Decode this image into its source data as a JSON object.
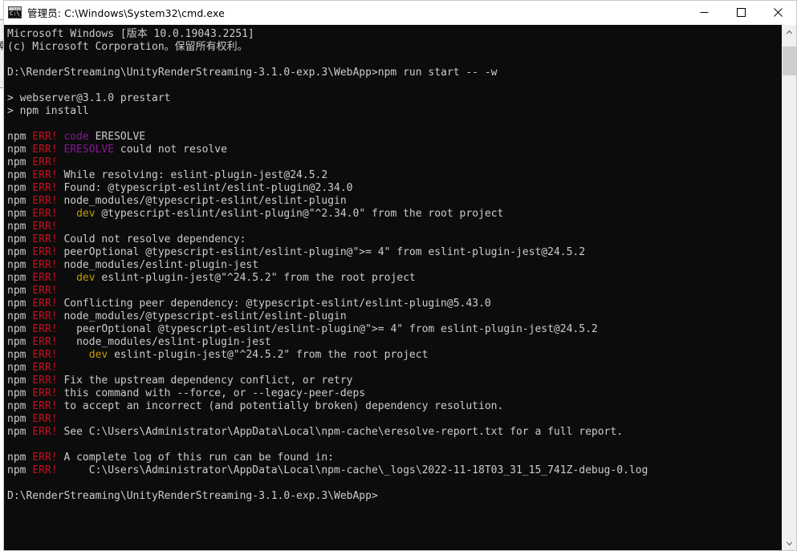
{
  "window": {
    "title": "管理员: C:\\Windows\\System32\\cmd.exe",
    "icon_name": "cmd-console-icon",
    "icon_glyph": "C:\\_",
    "controls": {
      "minimize_label": "最小化",
      "maximize_label": "最大化",
      "close_label": "关闭"
    }
  },
  "background_fragment": {
    "glyph": "朝"
  },
  "scrollbar": {
    "up_arrow": "▲",
    "down_arrow": "▼"
  },
  "colors": {
    "console_background": "#0c0c0c",
    "text_white": "#cccccc",
    "text_red": "#c50f1f",
    "text_magenta": "#881798",
    "text_yellow": "#c19c00",
    "titlebar_background": "#ffffff",
    "scrollbar_track": "#f0f0f0",
    "scrollbar_thumb": "#cdcdcd"
  },
  "console": {
    "prompt_path": "D:\\RenderStreaming\\UnityRenderStreaming-3.1.0-exp.3\\WebApp>",
    "command": "npm run start -- -w",
    "lines": [
      [
        {
          "t": "Microsoft Windows [版本 10.0.19043.2251]",
          "c": "c-white"
        }
      ],
      [
        {
          "t": "(c) Microsoft Corporation。保留所有权利。",
          "c": "c-white"
        }
      ],
      [
        {
          "t": "",
          "c": "c-white"
        }
      ],
      [
        {
          "t": "D:\\RenderStreaming\\UnityRenderStreaming-3.1.0-exp.3\\WebApp>npm run start -- -w",
          "c": "c-white"
        }
      ],
      [
        {
          "t": "",
          "c": "c-white"
        }
      ],
      [
        {
          "t": "> webserver@3.1.0 prestart",
          "c": "c-white"
        }
      ],
      [
        {
          "t": "> npm install",
          "c": "c-white"
        }
      ],
      [
        {
          "t": "",
          "c": "c-white"
        }
      ],
      [
        {
          "t": "npm ",
          "c": "c-white"
        },
        {
          "t": "ERR!",
          "c": "c-red"
        },
        {
          "t": " ",
          "c": "c-white"
        },
        {
          "t": "code",
          "c": "c-magenta"
        },
        {
          "t": " ERESOLVE",
          "c": "c-white"
        }
      ],
      [
        {
          "t": "npm ",
          "c": "c-white"
        },
        {
          "t": "ERR!",
          "c": "c-red"
        },
        {
          "t": " ",
          "c": "c-white"
        },
        {
          "t": "ERESOLVE",
          "c": "c-magenta"
        },
        {
          "t": " could not resolve",
          "c": "c-white"
        }
      ],
      [
        {
          "t": "npm ",
          "c": "c-white"
        },
        {
          "t": "ERR!",
          "c": "c-red"
        }
      ],
      [
        {
          "t": "npm ",
          "c": "c-white"
        },
        {
          "t": "ERR!",
          "c": "c-red"
        },
        {
          "t": " While resolving: eslint-plugin-jest@24.5.2",
          "c": "c-white"
        }
      ],
      [
        {
          "t": "npm ",
          "c": "c-white"
        },
        {
          "t": "ERR!",
          "c": "c-red"
        },
        {
          "t": " Found: @typescript-eslint/eslint-plugin@2.34.0",
          "c": "c-white"
        }
      ],
      [
        {
          "t": "npm ",
          "c": "c-white"
        },
        {
          "t": "ERR!",
          "c": "c-red"
        },
        {
          "t": " node_modules/@typescript-eslint/eslint-plugin",
          "c": "c-white"
        }
      ],
      [
        {
          "t": "npm ",
          "c": "c-white"
        },
        {
          "t": "ERR!",
          "c": "c-red"
        },
        {
          "t": "   ",
          "c": "c-white"
        },
        {
          "t": "dev",
          "c": "c-yellow"
        },
        {
          "t": " @typescript-eslint/eslint-plugin@\"^2.34.0\" from the root project",
          "c": "c-white"
        }
      ],
      [
        {
          "t": "npm ",
          "c": "c-white"
        },
        {
          "t": "ERR!",
          "c": "c-red"
        }
      ],
      [
        {
          "t": "npm ",
          "c": "c-white"
        },
        {
          "t": "ERR!",
          "c": "c-red"
        },
        {
          "t": " Could not resolve dependency:",
          "c": "c-white"
        }
      ],
      [
        {
          "t": "npm ",
          "c": "c-white"
        },
        {
          "t": "ERR!",
          "c": "c-red"
        },
        {
          "t": " peerOptional @typescript-eslint/eslint-plugin@\">= 4\" from eslint-plugin-jest@24.5.2",
          "c": "c-white"
        }
      ],
      [
        {
          "t": "npm ",
          "c": "c-white"
        },
        {
          "t": "ERR!",
          "c": "c-red"
        },
        {
          "t": " node_modules/eslint-plugin-jest",
          "c": "c-white"
        }
      ],
      [
        {
          "t": "npm ",
          "c": "c-white"
        },
        {
          "t": "ERR!",
          "c": "c-red"
        },
        {
          "t": "   ",
          "c": "c-white"
        },
        {
          "t": "dev",
          "c": "c-yellow"
        },
        {
          "t": " eslint-plugin-jest@\"^24.5.2\" from the root project",
          "c": "c-white"
        }
      ],
      [
        {
          "t": "npm ",
          "c": "c-white"
        },
        {
          "t": "ERR!",
          "c": "c-red"
        }
      ],
      [
        {
          "t": "npm ",
          "c": "c-white"
        },
        {
          "t": "ERR!",
          "c": "c-red"
        },
        {
          "t": " Conflicting peer dependency: @typescript-eslint/eslint-plugin@5.43.0",
          "c": "c-white"
        }
      ],
      [
        {
          "t": "npm ",
          "c": "c-white"
        },
        {
          "t": "ERR!",
          "c": "c-red"
        },
        {
          "t": " node_modules/@typescript-eslint/eslint-plugin",
          "c": "c-white"
        }
      ],
      [
        {
          "t": "npm ",
          "c": "c-white"
        },
        {
          "t": "ERR!",
          "c": "c-red"
        },
        {
          "t": "   peerOptional @typescript-eslint/eslint-plugin@\">= 4\" from eslint-plugin-jest@24.5.2",
          "c": "c-white"
        }
      ],
      [
        {
          "t": "npm ",
          "c": "c-white"
        },
        {
          "t": "ERR!",
          "c": "c-red"
        },
        {
          "t": "   node_modules/eslint-plugin-jest",
          "c": "c-white"
        }
      ],
      [
        {
          "t": "npm ",
          "c": "c-white"
        },
        {
          "t": "ERR!",
          "c": "c-red"
        },
        {
          "t": "     ",
          "c": "c-white"
        },
        {
          "t": "dev",
          "c": "c-yellow"
        },
        {
          "t": " eslint-plugin-jest@\"^24.5.2\" from the root project",
          "c": "c-white"
        }
      ],
      [
        {
          "t": "npm ",
          "c": "c-white"
        },
        {
          "t": "ERR!",
          "c": "c-red"
        }
      ],
      [
        {
          "t": "npm ",
          "c": "c-white"
        },
        {
          "t": "ERR!",
          "c": "c-red"
        },
        {
          "t": " Fix the upstream dependency conflict, or retry",
          "c": "c-white"
        }
      ],
      [
        {
          "t": "npm ",
          "c": "c-white"
        },
        {
          "t": "ERR!",
          "c": "c-red"
        },
        {
          "t": " this command with --force, or --legacy-peer-deps",
          "c": "c-white"
        }
      ],
      [
        {
          "t": "npm ",
          "c": "c-white"
        },
        {
          "t": "ERR!",
          "c": "c-red"
        },
        {
          "t": " to accept an incorrect (and potentially broken) dependency resolution.",
          "c": "c-white"
        }
      ],
      [
        {
          "t": "npm ",
          "c": "c-white"
        },
        {
          "t": "ERR!",
          "c": "c-red"
        }
      ],
      [
        {
          "t": "npm ",
          "c": "c-white"
        },
        {
          "t": "ERR!",
          "c": "c-red"
        },
        {
          "t": " See C:\\Users\\Administrator\\AppData\\Local\\npm-cache\\eresolve-report.txt for a full report.",
          "c": "c-white"
        }
      ],
      [
        {
          "t": "",
          "c": "c-white"
        }
      ],
      [
        {
          "t": "npm ",
          "c": "c-white"
        },
        {
          "t": "ERR!",
          "c": "c-red"
        },
        {
          "t": " A complete log of this run can be found in:",
          "c": "c-white"
        }
      ],
      [
        {
          "t": "npm ",
          "c": "c-white"
        },
        {
          "t": "ERR!",
          "c": "c-red"
        },
        {
          "t": "     C:\\Users\\Administrator\\AppData\\Local\\npm-cache\\_logs\\2022-11-18T03_31_15_741Z-debug-0.log",
          "c": "c-white"
        }
      ],
      [
        {
          "t": "",
          "c": "c-white"
        }
      ],
      [
        {
          "t": "D:\\RenderStreaming\\UnityRenderStreaming-3.1.0-exp.3\\WebApp>",
          "c": "c-white"
        }
      ]
    ]
  }
}
